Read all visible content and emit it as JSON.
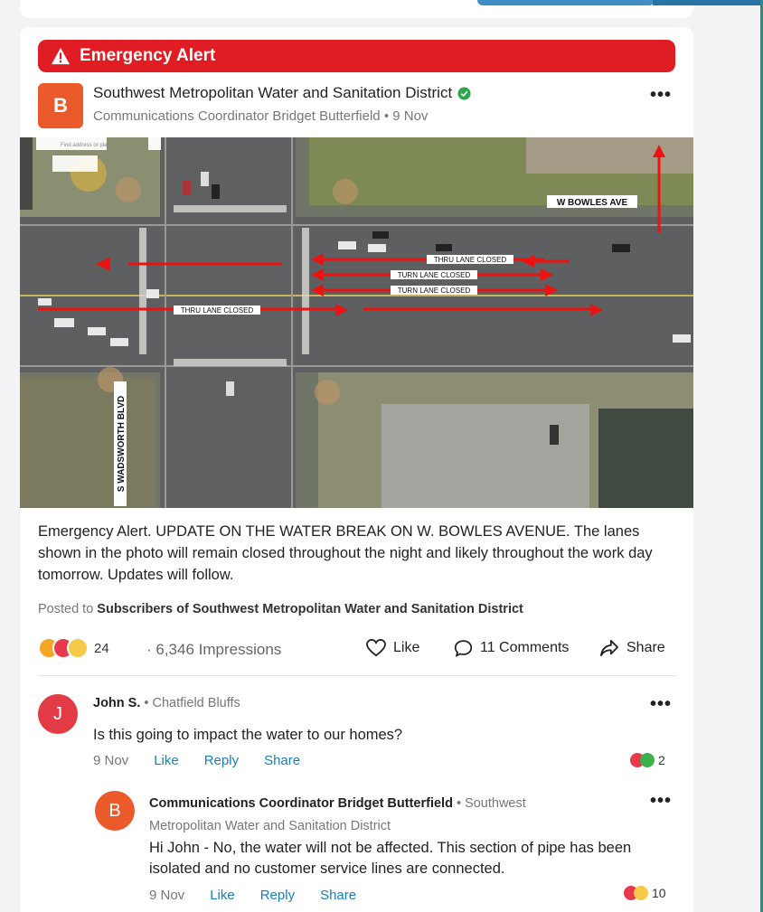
{
  "alert": {
    "label": "Emergency Alert"
  },
  "post": {
    "avatar_letter": "B",
    "org_name": "Southwest Metropolitan Water and Sanitation District",
    "meta": "Communications Coordinator Bridget Butterfield • 9 Nov",
    "more": "•••",
    "body": "Emergency Alert. UPDATE ON THE WATER BREAK ON W. BOWLES AVENUE. The lanes shown in the photo will remain closed throughout the night and likely throughout the work day tomorrow. Updates will follow.",
    "posted_to_prefix": "Posted to",
    "posted_to_group": "Subscribers of Southwest Metropolitan Water and Sanitation District",
    "reaction_count": "24",
    "impressions": "· 6,346 Impressions",
    "like_label": "Like",
    "comments_label": "11 Comments",
    "share_label": "Share"
  },
  "map": {
    "search_placeholder": "Find address or place",
    "street_east_west": "W BOWLES AVE",
    "street_north_south": "S WADSWORTH BLVD",
    "closure_labels": [
      "THRU LANE CLOSED",
      "TURN LANE CLOSED",
      "TURN LANE CLOSED",
      "THRU LANE CLOSED"
    ]
  },
  "comments": [
    {
      "avatar_letter": "J",
      "author": "John S.",
      "location": "• Chatfield Bluffs",
      "text": "Is this going to impact the water to our homes?",
      "date": "9 Nov",
      "like": "Like",
      "reply": "Reply",
      "share": "Share",
      "reaction_count": "2",
      "more": "•••"
    },
    {
      "avatar_letter": "B",
      "author": "Communications Coordinator Bridget Butterfield",
      "location_line1": "• Southwest",
      "location_line2": "Metropolitan Water and Sanitation District",
      "text": "Hi John - No, the water will not be affected. This section of pipe has been isolated and no customer service lines are connected.",
      "date": "9 Nov",
      "like": "Like",
      "reply": "Reply",
      "share": "Share",
      "reaction_count": "10",
      "more": "•••"
    }
  ],
  "colors": {
    "alert_red": "#e11d24",
    "org_orange": "#ea5a2a",
    "link_blue": "#1a7fb8",
    "verified_green": "#2aa84a"
  }
}
